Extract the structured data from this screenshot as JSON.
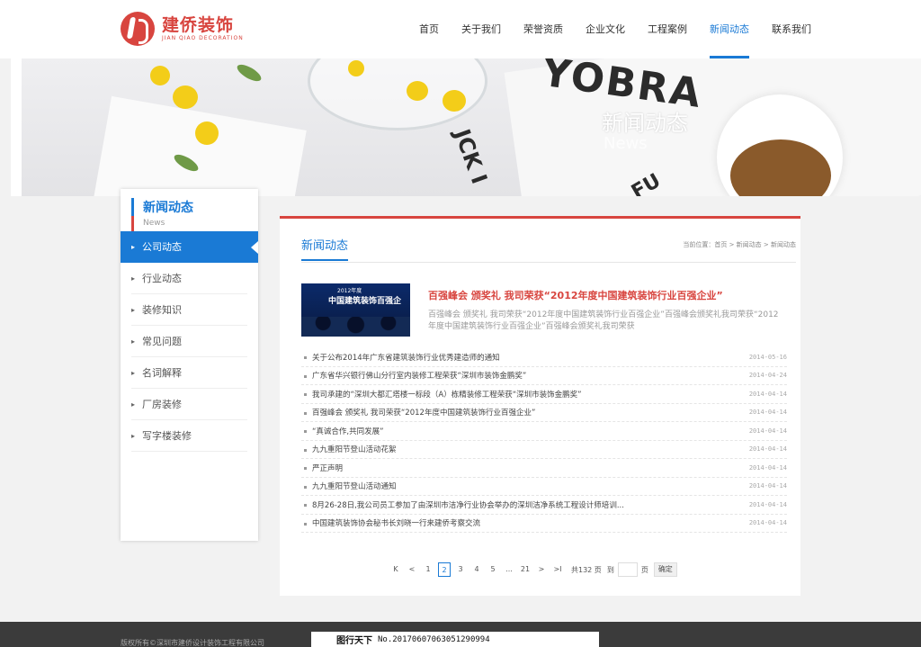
{
  "header": {
    "logo_cn": "建侨装饰",
    "logo_en": "JIAN QIAO DECORATION",
    "nav": [
      {
        "label": "首页",
        "active": false
      },
      {
        "label": "关于我们",
        "active": false
      },
      {
        "label": "荣誉资质",
        "active": false
      },
      {
        "label": "企业文化",
        "active": false
      },
      {
        "label": "工程案例",
        "active": false
      },
      {
        "label": "新闻动态",
        "active": true
      },
      {
        "label": "联系我们",
        "active": false
      }
    ]
  },
  "banner": {
    "title": "新闻动态",
    "subtitle": "News",
    "print_word": "YOBRA",
    "print_word2": "JCK I",
    "print_word3": "FU"
  },
  "sidebar": {
    "title": "新闻动态",
    "subtitle": "News",
    "items": [
      {
        "label": "公司动态",
        "active": true
      },
      {
        "label": "行业动态",
        "active": false
      },
      {
        "label": "装修知识",
        "active": false
      },
      {
        "label": "常见问题",
        "active": false
      },
      {
        "label": "名词解释",
        "active": false
      },
      {
        "label": "厂房装修",
        "active": false
      },
      {
        "label": "写字楼装修",
        "active": false
      }
    ]
  },
  "main": {
    "title": "新闻动态",
    "breadcrumb": "当前位置：首页 > 新闻动态 > 新闻动态",
    "featured": {
      "image_line1": "2012年度",
      "image_line2": "中国建筑装饰百强企",
      "title": "百强峰会 颁奖礼 我司荣获“2012年度中国建筑装饰行业百强企业”",
      "desc": "百强峰会  颁奖礼  我司荣获“2012年度中国建筑装饰行业百强企业”百强峰会颁奖礼我司荣获“2012年度中国建筑装饰行业百强企业”百强峰会颁奖礼我司荣获"
    },
    "news": [
      {
        "title": "关于公布2014年广东省建筑装饰行业优秀建造师的通知",
        "date": "2014-05-16"
      },
      {
        "title": "广东省华兴银行佛山分行室内装修工程荣获“深圳市装饰金鹏奖”",
        "date": "2014-04-24"
      },
      {
        "title": "我司承建的“深圳大都汇塔楼一标段（A）栋精装修工程荣获“深圳市装饰金鹏奖”",
        "date": "2014-04-14"
      },
      {
        "title": "百强峰会 颁奖礼 我司荣获“2012年度中国建筑装饰行业百强企业”",
        "date": "2014-04-14"
      },
      {
        "title": "“真诚合作,共同发展”",
        "date": "2014-04-14"
      },
      {
        "title": "九九重阳节登山活动花絮",
        "date": "2014-04-14"
      },
      {
        "title": "严正声明",
        "date": "2014-04-14"
      },
      {
        "title": "九九重阳节登山活动通知",
        "date": "2014-04-14"
      },
      {
        "title": "8月26-28日,我公司员工参加了由深圳市洁净行业协会举办的深圳洁净系统工程设计师培训...",
        "date": "2014-04-14"
      },
      {
        "title": "中国建筑装饰协会秘书长刘晓一行来建侨考察交流",
        "date": "2014-04-14"
      }
    ],
    "pager": {
      "first": "K",
      "prev": "<",
      "pages": [
        "1",
        "2",
        "3",
        "4",
        "5"
      ],
      "current": "2",
      "ellipsis": "...",
      "last_page": "21",
      "next": ">",
      "last": ">I",
      "total": "共132 页",
      "goto_label": "到",
      "goto_unit": "页",
      "confirm": "确定"
    }
  },
  "footer": {
    "copyright": "版权所有©深圳市建侨设计装饰工程有限公司"
  },
  "watermark": {
    "brand": "图行天下",
    "id_text": "No.20170607063051290994"
  },
  "colors": {
    "accent": "#1a7ad5",
    "brand_red": "#d8453f"
  }
}
